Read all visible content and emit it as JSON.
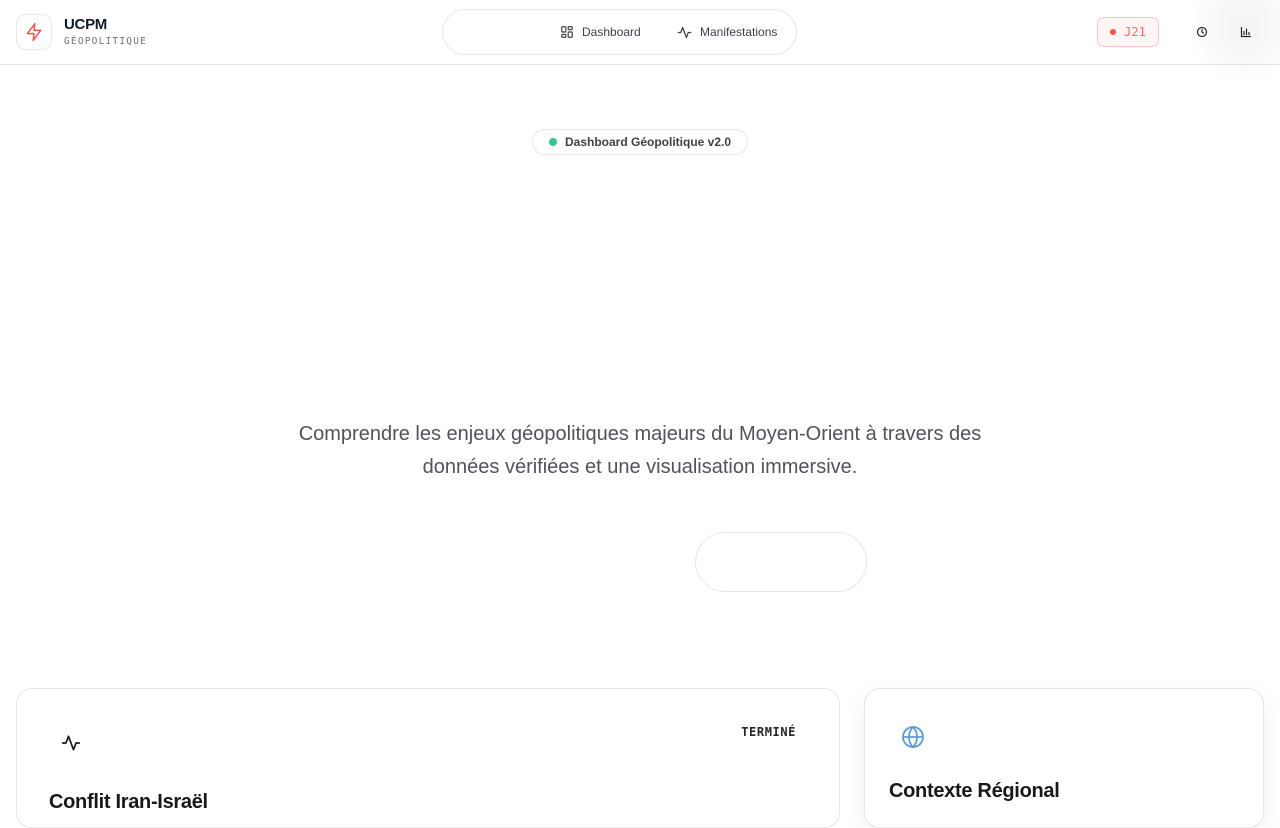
{
  "brand": {
    "title": "UCPM",
    "subtitle": "GÉOPOLITIQUE"
  },
  "nav": {
    "items": [
      {
        "label": "Dashboard",
        "icon": "dashboard-grid-icon"
      },
      {
        "label": "Manifestations",
        "icon": "activity-pulse-icon"
      }
    ]
  },
  "header": {
    "day_badge": "J21",
    "clock_icon": "clock-icon",
    "chart_icon": "bar-chart-icon"
  },
  "hero": {
    "badge": "Dashboard Géopolitique v2.0",
    "description": "Comprendre les enjeux géopolitiques majeurs du Moyen-Orient à travers des données vérifiées et une visualisation immersive."
  },
  "cards": [
    {
      "status": "TERMINÉ",
      "title": "Conflit Iran-Israël",
      "icon": "activity-pulse-icon"
    },
    {
      "title": "Contexte Régional",
      "icon": "globe-icon"
    }
  ],
  "colors": {
    "accent_red": "#ef5350",
    "status_green": "#34c38f",
    "globe_blue": "#5b9bd5"
  }
}
